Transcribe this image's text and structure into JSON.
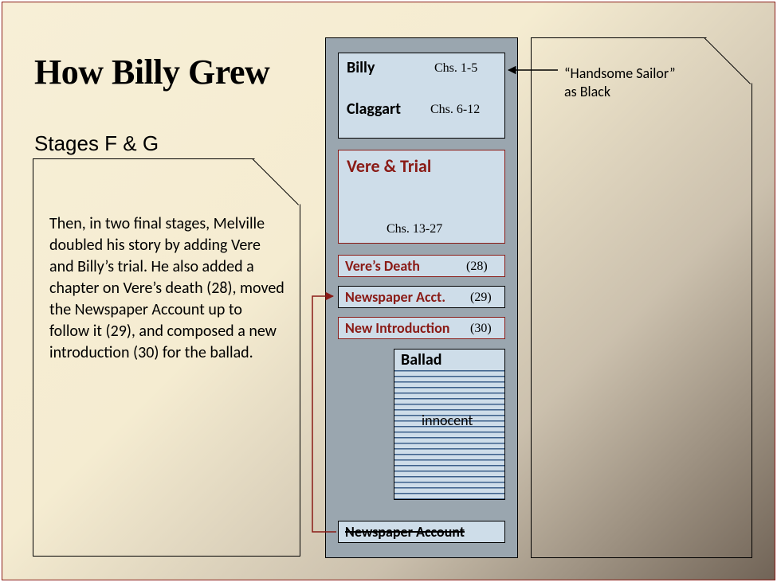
{
  "title": "How Billy Grew",
  "subtitle": "Stages F & G",
  "left_panel_body": "Then, in two final stages, Melville doubled his story by adding Vere and Billy’s trial.  He also added a chapter on Vere’s death (28), moved the Newspaper Account up to follow it (29), and composed a new introduction (30) for the ballad.",
  "annotation_line1": "“Handsome Sailor”",
  "annotation_line2": "as Black",
  "center": {
    "billy": {
      "label": "Billy",
      "chapters": "Chs. 1-5"
    },
    "claggart": {
      "label": "Claggart",
      "chapters": "Chs. 6-12"
    },
    "vere_trial": {
      "label": "Vere & Trial",
      "chapters": "Chs. 13-27"
    },
    "vere_death": {
      "label": "Vere’s Death",
      "chapters": "(28)"
    },
    "newspaper_acct": {
      "label": "Newspaper Acct.",
      "chapters": "(29)"
    },
    "new_intro": {
      "label": "New Introduction",
      "chapters": "(30)"
    },
    "ballad": {
      "label": "Ballad",
      "note": "innocent"
    },
    "newspaper_old": {
      "label": "Newspaper Account"
    }
  }
}
